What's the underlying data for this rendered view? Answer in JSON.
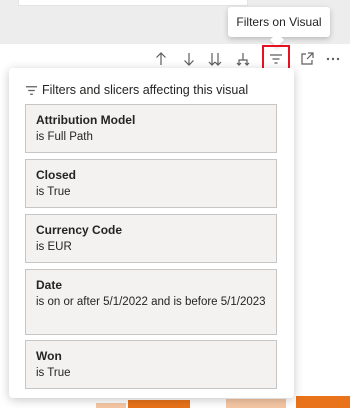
{
  "tooltip": {
    "text": "Filters on Visual"
  },
  "toolbar": {
    "icons": [
      "sort-ascending-icon",
      "sort-descending-icon",
      "expand-all-icon",
      "drill-up-icon",
      "filter-icon",
      "focus-mode-icon",
      "more-options-icon"
    ]
  },
  "panel": {
    "header": "Filters and slicers affecting this visual",
    "filters": [
      {
        "name": "Attribution Model",
        "condition": "is Full Path"
      },
      {
        "name": "Closed",
        "condition": "is True"
      },
      {
        "name": "Currency Code",
        "condition": "is EUR"
      },
      {
        "name": "Date",
        "condition": "is on or after 5/1/2022 and is before 5/1/2023"
      },
      {
        "name": "Won",
        "condition": "is True"
      }
    ]
  },
  "colors": {
    "highlight_border": "#e81123",
    "card_bg": "#f3f2f1",
    "card_border": "#c8c6c4",
    "bar_orange": "#e8731a",
    "bar_light": "#f6c7a4"
  }
}
